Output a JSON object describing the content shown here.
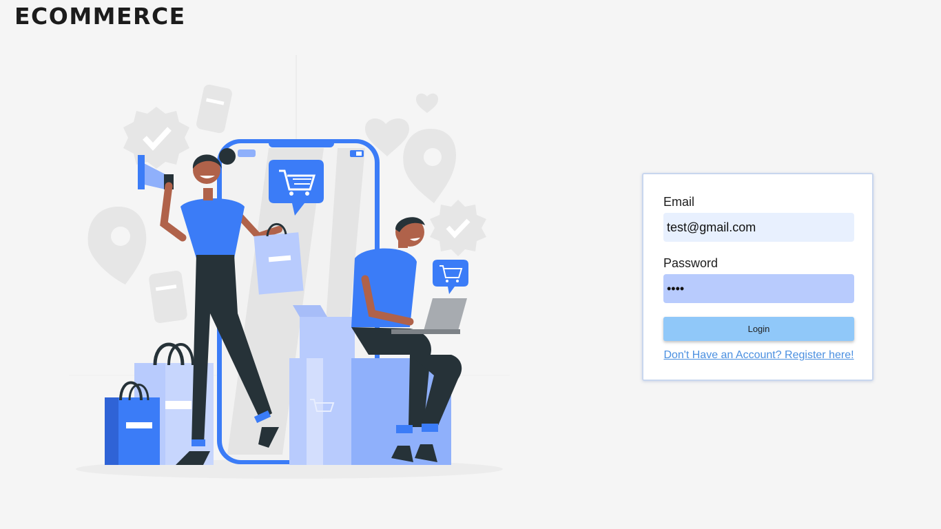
{
  "brand": {
    "title": "ECOMMERCE"
  },
  "login_form": {
    "email_label": "Email",
    "email_value": "test@gmail.com",
    "password_label": "Password",
    "password_value": "••••",
    "login_label": "Login",
    "register_link": "Don't Have an Account? Register here!"
  },
  "colors": {
    "accent_blue": "#3b7cf7",
    "light_blue": "#b8cbfd",
    "button_blue": "#90c8f9",
    "link_blue": "#4a8fe0",
    "dark_navy": "#263238"
  },
  "illustration": {
    "icons": [
      "megaphone-icon",
      "shopping-cart-icon",
      "heart-icon",
      "location-pin-icon",
      "check-badge-icon",
      "price-tag-icon",
      "shopping-bag-icon",
      "laptop-icon"
    ]
  }
}
